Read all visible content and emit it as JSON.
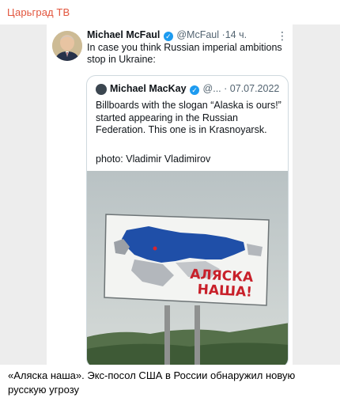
{
  "channel": {
    "name": "Царьград ТВ"
  },
  "tweet": {
    "author_name": "Michael McFaul",
    "handle": "@McFaul",
    "separator": "·",
    "time": "14 ч.",
    "text": "In case you think Russian imperial ambitions stop in Ukraine:",
    "more_icon": "more-horizontal-icon"
  },
  "quoted_tweet": {
    "author_name": "Michael MacKay",
    "handle_truncated": "@...",
    "separator": "·",
    "date": "07.07.2022",
    "text": "Billboards with the slogan “Alaska is ours!” started appearing in the Russian Federation. This one is in Krasnoyarsk.",
    "credit": "photo: Vladimir Vladimirov",
    "photo": {
      "billboard_line1": "АЛЯСКА",
      "billboard_line2": "НАША!"
    }
  },
  "post": {
    "caption": "«Аляска наша». Экс-посол США в России обнаружил новую русскую угрозу"
  },
  "colors": {
    "channel_accent": "#e2553d",
    "verified_blue": "#1d9bf0",
    "billboard_red": "#c8202a",
    "map_blue": "#1f4fa8"
  }
}
